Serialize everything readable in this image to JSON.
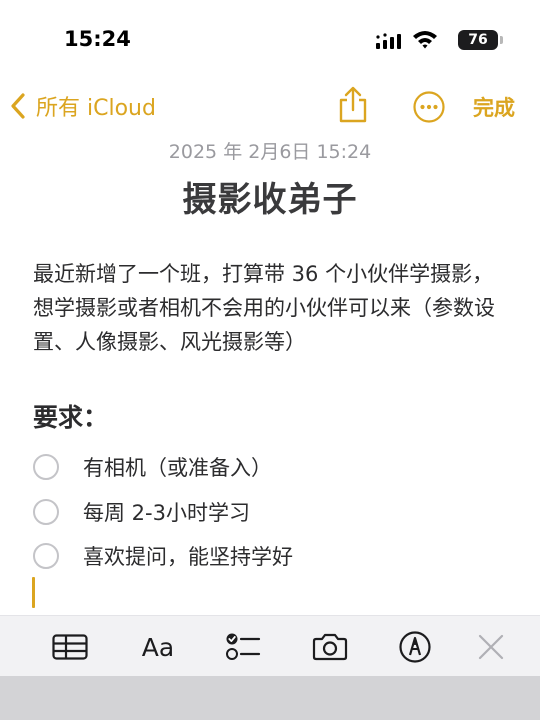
{
  "status_bar": {
    "time": "15:24",
    "battery": "76",
    "icons": [
      "signal-icon",
      "wifi-icon",
      "battery-icon"
    ]
  },
  "nav": {
    "back_label": "所有 iCloud",
    "done_label": "完成",
    "icons": [
      "chevron-left-icon",
      "share-icon",
      "more-icon"
    ],
    "accent_color": "#dba520"
  },
  "note": {
    "date": "2025 年 2月6日 15:24",
    "title": "摄影收弟子",
    "body": "最近新增了一个班，打算带 36 个小伙伴学摄影，想学摄影或者相机不会用的小伙伴可以来（参数设置、人像摄影、风光摄影等）",
    "heading": "要求：",
    "checklist": [
      {
        "text": "有相机（或准备入）",
        "checked": false
      },
      {
        "text": "每周 2-3小时学习",
        "checked": false
      },
      {
        "text": "喜欢提问，能坚持学好",
        "checked": false
      }
    ]
  },
  "toolbar": {
    "text_format_label": "Aa",
    "icons": [
      "table-icon",
      "text-format-icon",
      "checklist-icon",
      "camera-icon",
      "markup-icon",
      "close-icon"
    ]
  }
}
